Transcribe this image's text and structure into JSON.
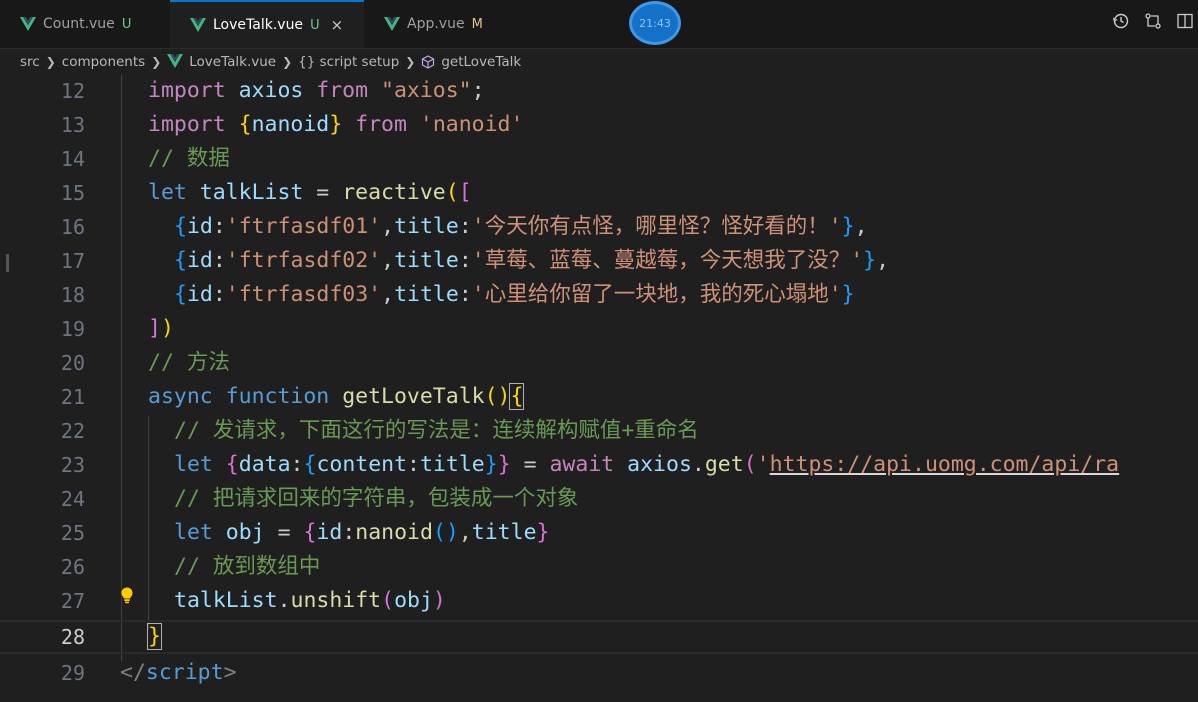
{
  "tabs": [
    {
      "name": "Count.vue",
      "status": "U",
      "active": false
    },
    {
      "name": "LoveTalk.vue",
      "status": "U",
      "active": true,
      "close": "×"
    },
    {
      "name": "App.vue",
      "status": "M",
      "active": false
    }
  ],
  "timer": "21:43",
  "breadcrumb": {
    "folder1": "src",
    "folder2": "components",
    "file": "LoveTalk.vue",
    "section": "{} script setup",
    "symbol": "getLoveTalk"
  },
  "line_numbers": [
    "12",
    "13",
    "14",
    "15",
    "16",
    "17",
    "18",
    "19",
    "20",
    "21",
    "22",
    "23",
    "24",
    "25",
    "26",
    "27",
    "28",
    "29"
  ],
  "code": {
    "l12": {
      "a": "import",
      "b": " axios ",
      "c": "from",
      "d": " \"axios\"",
      "e": ";"
    },
    "l13": {
      "a": "import",
      "b": " ",
      "c": "{",
      "d": "nanoid",
      "e": "}",
      "f": " from ",
      "g": "'nanoid'"
    },
    "l14": {
      "a": "// 数据"
    },
    "l15": {
      "a": "let",
      "b": " ",
      "c": "talkList",
      "d": " = ",
      "e": "reactive",
      "f": "(",
      "g": "["
    },
    "l16": {
      "a": "{",
      "b": "id",
      "c": ":",
      "d": "'ftrfasdf01'",
      "e": ",",
      "f": "title",
      "g": ":",
      "h": "'今天你有点怪，哪里怪？怪好看的！'",
      "i": "}",
      "j": ","
    },
    "l17": {
      "a": "{",
      "b": "id",
      "c": ":",
      "d": "'ftrfasdf02'",
      "e": ",",
      "f": "title",
      "g": ":",
      "h": "'草莓、蓝莓、蔓越莓，今天想我了没？'",
      "i": "}",
      "j": ","
    },
    "l18": {
      "a": "{",
      "b": "id",
      "c": ":",
      "d": "'ftrfasdf03'",
      "e": ",",
      "f": "title",
      "g": ":",
      "h": "'心里给你留了一块地，我的死心塌地'",
      "i": "}"
    },
    "l19": {
      "a": "]",
      "b": ")"
    },
    "l20": {
      "a": "// 方法"
    },
    "l21": {
      "a": "async",
      "b": " ",
      "c": "function",
      "d": " ",
      "e": "getLoveTalk",
      "f": "()",
      "g": "{"
    },
    "l22": {
      "a": "// 发请求，下面这行的写法是：连续解构赋值+重命名"
    },
    "l23": {
      "a": "let",
      "b": " ",
      "c": "{",
      "d": "data",
      "e": ":",
      "f": "{",
      "g": "content",
      "h": ":",
      "i": "title",
      "j": "}",
      "k": "}",
      "l": " = ",
      "m": "await",
      "n": " ",
      "o": "axios",
      "p": ".",
      "q": "get",
      "r": "(",
      "s": "'",
      "t": "https://api.uomg.com/api/ra"
    },
    "l24": {
      "a": "// 把请求回来的字符串，包装成一个对象"
    },
    "l25": {
      "a": "let",
      "b": " ",
      "c": "obj",
      "d": " = ",
      "e": "{",
      "f": "id",
      "g": ":",
      "h": "nanoid",
      "i": "()",
      "j": ",",
      "k": "title",
      "l": "}"
    },
    "l26": {
      "a": "// 放到数组中"
    },
    "l27": {
      "a": "talkList",
      "b": ".",
      "c": "unshift",
      "d": "(",
      "e": "obj",
      "f": ")"
    },
    "l28": {
      "a": "}"
    },
    "l29": {
      "a": "</",
      "b": "script",
      "c": ">"
    }
  },
  "colors": {
    "accent": "#0078d4",
    "keyword": "#569cd6",
    "control": "#c586c0",
    "function": "#dcdcaa",
    "variable": "#9cdcfe",
    "string": "#ce9178",
    "comment": "#6a9955"
  },
  "icons": {
    "tab_file": "vue-logo-icon",
    "timer": "timer-badge",
    "actions": [
      "timeline-icon",
      "compare-changes-icon",
      "split-editor-icon"
    ],
    "breadcrumb_symbol": "method-icon",
    "gutter": "lightbulb-icon"
  }
}
